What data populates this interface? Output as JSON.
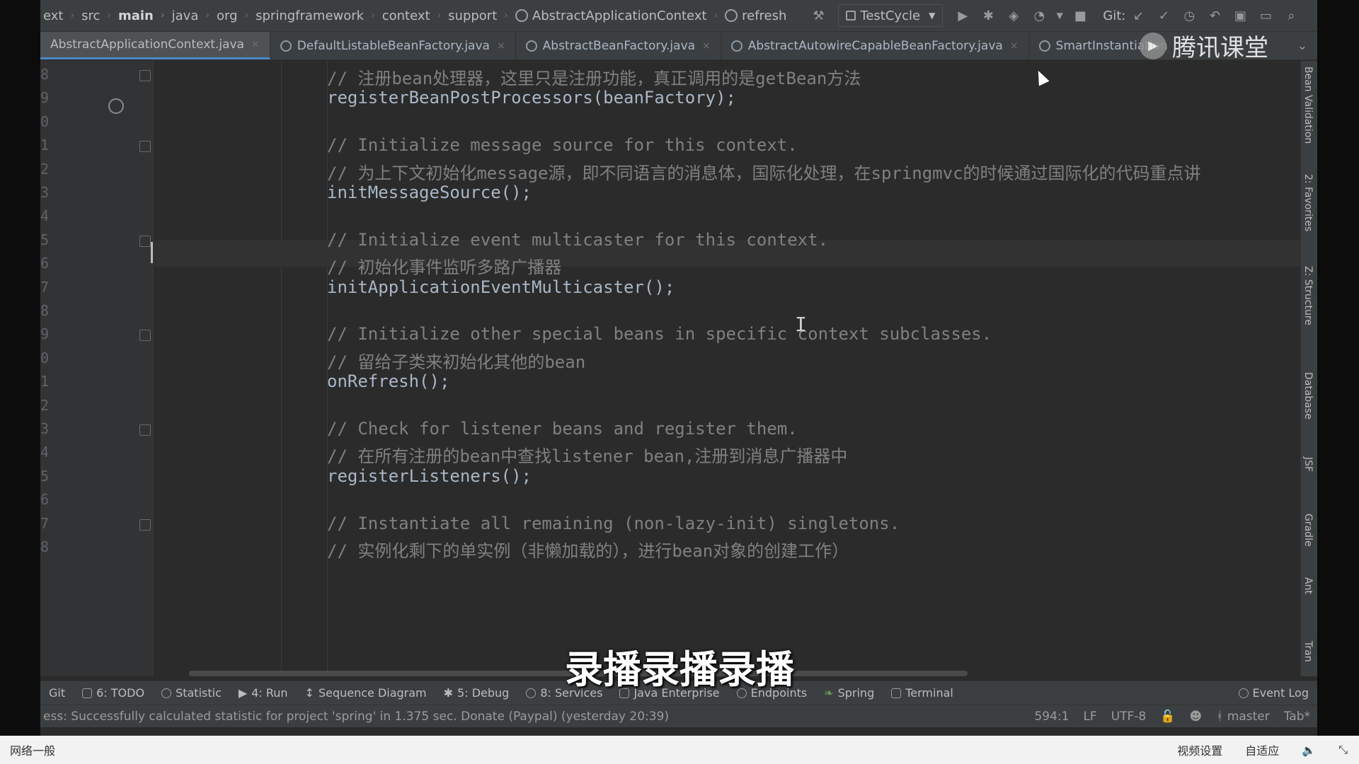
{
  "breadcrumbs": [
    "ext",
    "src",
    "main",
    "java",
    "org",
    "springframework",
    "context",
    "support",
    "AbstractApplicationContext",
    "refresh"
  ],
  "run_config": "TestCycle",
  "git_label": "Git:",
  "tabs": [
    {
      "label": "AbstractApplicationContext.java",
      "active": true
    },
    {
      "label": "DefaultListableBeanFactory.java",
      "active": false
    },
    {
      "label": "AbstractBeanFactory.java",
      "active": false
    },
    {
      "label": "AbstractAutowireCapableBeanFactory.java",
      "active": false
    },
    {
      "label": "SmartInstantiation",
      "active": false
    }
  ],
  "gutter_lines": [
    "8",
    "9",
    "0",
    "1",
    "2",
    "3",
    "4",
    "5",
    "6",
    "7",
    "8",
    "9",
    "0",
    "1",
    "2",
    "3",
    "4",
    "5",
    "6",
    "7",
    "8"
  ],
  "code_lines": [
    {
      "text": "// 注册bean处理器，这里只是注册功能，真正调用的是getBean方法",
      "type": "comment"
    },
    {
      "text": "registerBeanPostProcessors(beanFactory);",
      "type": "code"
    },
    {
      "text": "",
      "type": "code"
    },
    {
      "text": "// Initialize message source for this context.",
      "type": "comment"
    },
    {
      "text": "// 为上下文初始化message源，即不同语言的消息体，国际化处理，在springmvc的时候通过国际化的代码重点讲",
      "type": "comment"
    },
    {
      "text": "initMessageSource();",
      "type": "code"
    },
    {
      "text": "",
      "type": "code"
    },
    {
      "text": "// Initialize event multicaster for this context.",
      "type": "comment"
    },
    {
      "text": "// 初始化事件监听多路广播器",
      "type": "comment"
    },
    {
      "text": "initApplicationEventMulticaster();",
      "type": "code"
    },
    {
      "text": "",
      "type": "code"
    },
    {
      "text": "// Initialize other special beans in specific context subclasses.",
      "type": "comment"
    },
    {
      "text": "// 留给子类来初始化其他的bean",
      "type": "comment"
    },
    {
      "text": "onRefresh();",
      "type": "code"
    },
    {
      "text": "",
      "type": "code"
    },
    {
      "text": "// Check for listener beans and register them.",
      "type": "comment"
    },
    {
      "text": "// 在所有注册的bean中查找listener bean,注册到消息广播器中",
      "type": "comment"
    },
    {
      "text": "registerListeners();",
      "type": "code"
    },
    {
      "text": "",
      "type": "code"
    },
    {
      "text": "// Instantiate all remaining (non-lazy-init) singletons.",
      "type": "comment"
    },
    {
      "text": "// 实例化剩下的单实例（非懒加载的），进行bean对象的创建工作）",
      "type": "comment"
    }
  ],
  "right_tools": [
    "Bean Validation",
    "2: Favorites",
    "Z: Structure",
    "Database",
    "JSF",
    "Gradle",
    "Ant",
    "Tran"
  ],
  "bottom_tools": [
    {
      "label": "Git"
    },
    {
      "label": "6: TODO"
    },
    {
      "label": "Statistic"
    },
    {
      "label": "4: Run"
    },
    {
      "label": "Sequence Diagram"
    },
    {
      "label": "5: Debug"
    },
    {
      "label": "8: Services"
    },
    {
      "label": "Java Enterprise"
    },
    {
      "label": "Endpoints"
    },
    {
      "label": "Spring"
    },
    {
      "label": "Terminal"
    }
  ],
  "event_log": "Event Log",
  "status": {
    "message": "ess: Successfully calculated statistic for project 'spring' in 1.375 sec. Donate (Paypal) (yesterday 20:39)",
    "position": "594:1",
    "line_sep": "LF",
    "encoding": "UTF-8",
    "branch": "master",
    "indent": "Tab*"
  },
  "watermark": "腾讯课堂",
  "subtitle": "录播录播录播",
  "player": {
    "network": "网络一般",
    "video_settings": "视频设置",
    "adaptive": "自适应"
  }
}
